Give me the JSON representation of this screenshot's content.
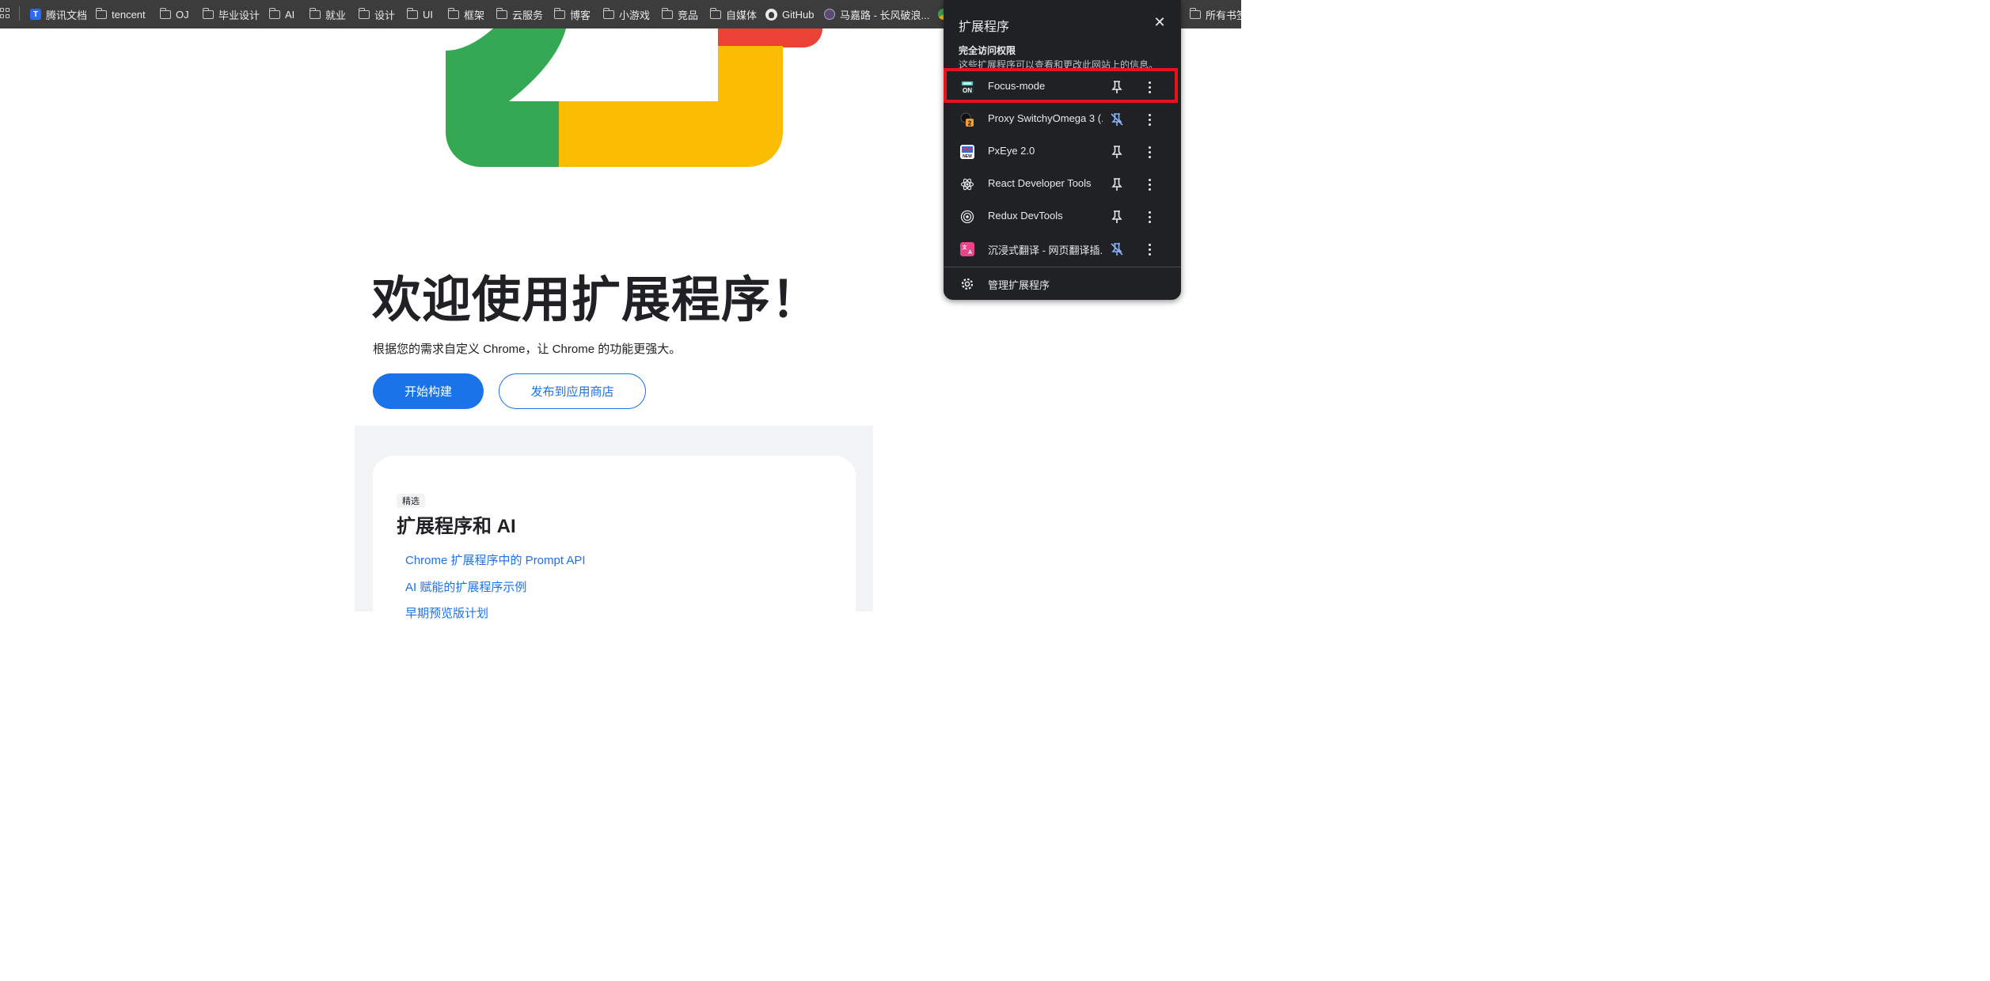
{
  "bookmarks": {
    "items": [
      {
        "label": "腾讯文档",
        "icon": "tencent-docs-icon"
      },
      {
        "label": "tencent",
        "icon": "folder-icon"
      },
      {
        "label": "OJ",
        "icon": "folder-icon"
      },
      {
        "label": "毕业设计",
        "icon": "folder-icon"
      },
      {
        "label": "AI",
        "icon": "folder-icon"
      },
      {
        "label": "就业",
        "icon": "folder-icon"
      },
      {
        "label": "设计",
        "icon": "folder-icon"
      },
      {
        "label": "UI",
        "icon": "folder-icon"
      },
      {
        "label": "框架",
        "icon": "folder-icon"
      },
      {
        "label": "云服务",
        "icon": "folder-icon"
      },
      {
        "label": "博客",
        "icon": "folder-icon"
      },
      {
        "label": "小游戏",
        "icon": "folder-icon"
      },
      {
        "label": "竞品",
        "icon": "folder-icon"
      },
      {
        "label": "自媒体",
        "icon": "folder-icon"
      },
      {
        "label": "GitHub",
        "icon": "github-icon"
      },
      {
        "label": "马嘉路 - 长风破浪...",
        "icon": "globe-icon"
      }
    ],
    "all_bookmarks": "所有书签"
  },
  "hero": {
    "title": "欢迎使用扩展程序！",
    "subtitle": "根据您的需求自定义 Chrome，让 Chrome 的功能更强大。",
    "primary_button": "开始构建",
    "secondary_button": "发布到应用商店"
  },
  "featured": {
    "chip": "精选",
    "title": "扩展程序和 AI",
    "links": [
      "Chrome 扩展程序中的 Prompt API",
      "AI 赋能的扩展程序示例",
      "早期预览版计划"
    ]
  },
  "extensions_popup": {
    "title": "扩展程序",
    "section_title": "完全访问权限",
    "section_desc": "这些扩展程序可以查看和更改此网站上的信息。",
    "items": [
      {
        "name": "Focus-mode",
        "icon": "focus-mode-icon",
        "pinned": true,
        "highlighted": true
      },
      {
        "name": "Proxy SwitchyOmega 3 (...",
        "icon": "proxy-switchyomega-icon",
        "pinned": false
      },
      {
        "name": "PxEye 2.0",
        "icon": "pxeye-icon",
        "pinned": true
      },
      {
        "name": "React Developer Tools",
        "icon": "react-icon",
        "pinned": true
      },
      {
        "name": "Redux DevTools",
        "icon": "redux-icon",
        "pinned": true
      },
      {
        "name": "沉浸式翻译 - 网页翻译插...",
        "icon": "immersive-translate-icon",
        "pinned": false
      }
    ],
    "manage_label": "管理扩展程序"
  },
  "colors": {
    "accent": "#1a73e8",
    "popup_bg": "#202124",
    "bookmarks_bg": "#3c3c3c",
    "highlight": "#e8131b",
    "google_green": "#34a853",
    "google_yellow": "#fbbc04",
    "google_red": "#ea4335",
    "unpinned_icon": "#8ab4f8"
  }
}
